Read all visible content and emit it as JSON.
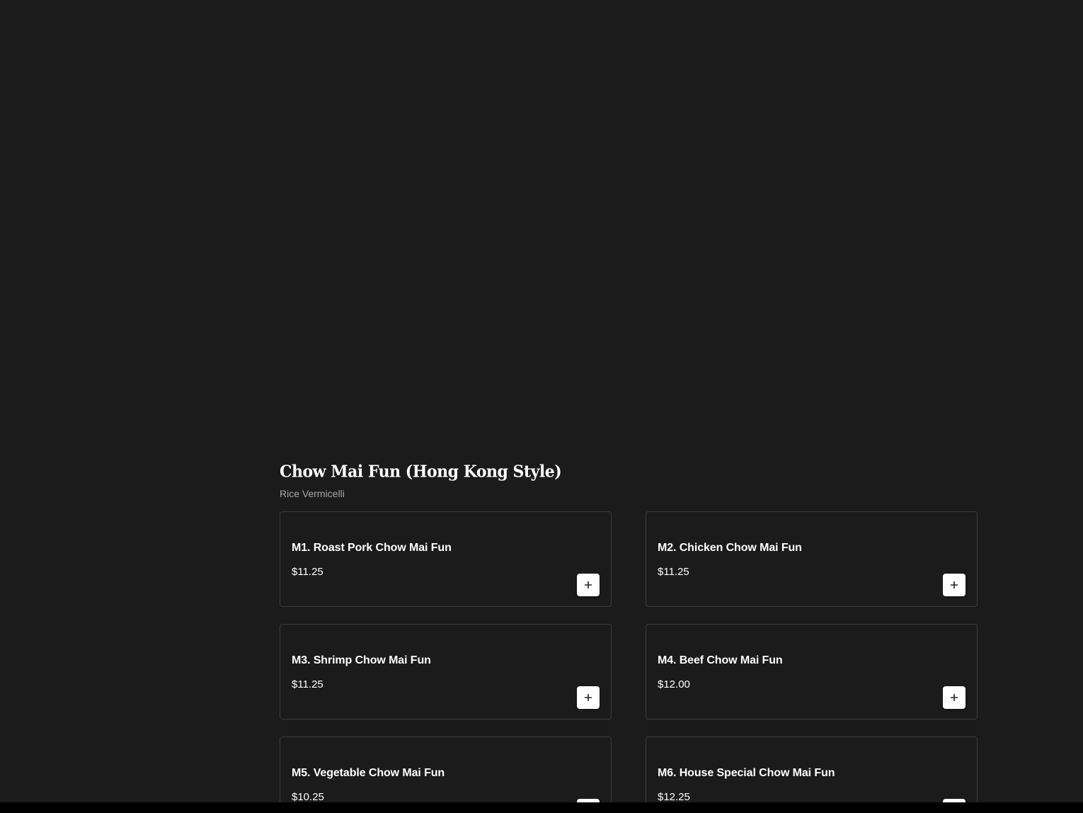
{
  "section": {
    "title": "Chow Mai Fun (Hong Kong Style)",
    "subtitle": "Rice Vermicelli"
  },
  "items": [
    {
      "name": "M1. Roast Pork Chow Mai Fun",
      "price": "$11.25"
    },
    {
      "name": "M2. Chicken Chow Mai Fun",
      "price": "$11.25"
    },
    {
      "name": "M3. Shrimp Chow Mai Fun",
      "price": "$11.25"
    },
    {
      "name": "M4. Beef Chow Mai Fun",
      "price": "$12.00"
    },
    {
      "name": "M5. Vegetable Chow Mai Fun",
      "price": "$10.25"
    },
    {
      "name": "M6. House Special Chow Mai Fun",
      "price": "$12.25"
    }
  ],
  "icons": {
    "add": "plus-icon"
  },
  "colors": {
    "background": "#1b1b1c",
    "card_border": "#3b3b3d",
    "subtitle": "#a9a9a9",
    "button": "#ffffff"
  }
}
